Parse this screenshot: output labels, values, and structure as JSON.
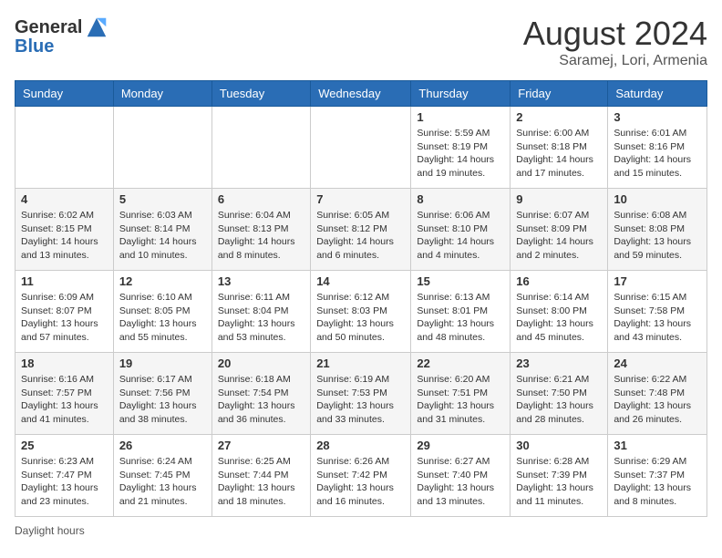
{
  "header": {
    "logo": {
      "general": "General",
      "blue": "Blue"
    },
    "title": "August 2024",
    "location": "Saramej, Lori, Armenia"
  },
  "days_of_week": [
    "Sunday",
    "Monday",
    "Tuesday",
    "Wednesday",
    "Thursday",
    "Friday",
    "Saturday"
  ],
  "weeks": [
    [
      {
        "day": null
      },
      {
        "day": null
      },
      {
        "day": null
      },
      {
        "day": null
      },
      {
        "day": 1,
        "sunrise": "Sunrise: 5:59 AM",
        "sunset": "Sunset: 8:19 PM",
        "daylight": "Daylight: 14 hours and 19 minutes."
      },
      {
        "day": 2,
        "sunrise": "Sunrise: 6:00 AM",
        "sunset": "Sunset: 8:18 PM",
        "daylight": "Daylight: 14 hours and 17 minutes."
      },
      {
        "day": 3,
        "sunrise": "Sunrise: 6:01 AM",
        "sunset": "Sunset: 8:16 PM",
        "daylight": "Daylight: 14 hours and 15 minutes."
      }
    ],
    [
      {
        "day": 4,
        "sunrise": "Sunrise: 6:02 AM",
        "sunset": "Sunset: 8:15 PM",
        "daylight": "Daylight: 14 hours and 13 minutes."
      },
      {
        "day": 5,
        "sunrise": "Sunrise: 6:03 AM",
        "sunset": "Sunset: 8:14 PM",
        "daylight": "Daylight: 14 hours and 10 minutes."
      },
      {
        "day": 6,
        "sunrise": "Sunrise: 6:04 AM",
        "sunset": "Sunset: 8:13 PM",
        "daylight": "Daylight: 14 hours and 8 minutes."
      },
      {
        "day": 7,
        "sunrise": "Sunrise: 6:05 AM",
        "sunset": "Sunset: 8:12 PM",
        "daylight": "Daylight: 14 hours and 6 minutes."
      },
      {
        "day": 8,
        "sunrise": "Sunrise: 6:06 AM",
        "sunset": "Sunset: 8:10 PM",
        "daylight": "Daylight: 14 hours and 4 minutes."
      },
      {
        "day": 9,
        "sunrise": "Sunrise: 6:07 AM",
        "sunset": "Sunset: 8:09 PM",
        "daylight": "Daylight: 14 hours and 2 minutes."
      },
      {
        "day": 10,
        "sunrise": "Sunrise: 6:08 AM",
        "sunset": "Sunset: 8:08 PM",
        "daylight": "Daylight: 13 hours and 59 minutes."
      }
    ],
    [
      {
        "day": 11,
        "sunrise": "Sunrise: 6:09 AM",
        "sunset": "Sunset: 8:07 PM",
        "daylight": "Daylight: 13 hours and 57 minutes."
      },
      {
        "day": 12,
        "sunrise": "Sunrise: 6:10 AM",
        "sunset": "Sunset: 8:05 PM",
        "daylight": "Daylight: 13 hours and 55 minutes."
      },
      {
        "day": 13,
        "sunrise": "Sunrise: 6:11 AM",
        "sunset": "Sunset: 8:04 PM",
        "daylight": "Daylight: 13 hours and 53 minutes."
      },
      {
        "day": 14,
        "sunrise": "Sunrise: 6:12 AM",
        "sunset": "Sunset: 8:03 PM",
        "daylight": "Daylight: 13 hours and 50 minutes."
      },
      {
        "day": 15,
        "sunrise": "Sunrise: 6:13 AM",
        "sunset": "Sunset: 8:01 PM",
        "daylight": "Daylight: 13 hours and 48 minutes."
      },
      {
        "day": 16,
        "sunrise": "Sunrise: 6:14 AM",
        "sunset": "Sunset: 8:00 PM",
        "daylight": "Daylight: 13 hours and 45 minutes."
      },
      {
        "day": 17,
        "sunrise": "Sunrise: 6:15 AM",
        "sunset": "Sunset: 7:58 PM",
        "daylight": "Daylight: 13 hours and 43 minutes."
      }
    ],
    [
      {
        "day": 18,
        "sunrise": "Sunrise: 6:16 AM",
        "sunset": "Sunset: 7:57 PM",
        "daylight": "Daylight: 13 hours and 41 minutes."
      },
      {
        "day": 19,
        "sunrise": "Sunrise: 6:17 AM",
        "sunset": "Sunset: 7:56 PM",
        "daylight": "Daylight: 13 hours and 38 minutes."
      },
      {
        "day": 20,
        "sunrise": "Sunrise: 6:18 AM",
        "sunset": "Sunset: 7:54 PM",
        "daylight": "Daylight: 13 hours and 36 minutes."
      },
      {
        "day": 21,
        "sunrise": "Sunrise: 6:19 AM",
        "sunset": "Sunset: 7:53 PM",
        "daylight": "Daylight: 13 hours and 33 minutes."
      },
      {
        "day": 22,
        "sunrise": "Sunrise: 6:20 AM",
        "sunset": "Sunset: 7:51 PM",
        "daylight": "Daylight: 13 hours and 31 minutes."
      },
      {
        "day": 23,
        "sunrise": "Sunrise: 6:21 AM",
        "sunset": "Sunset: 7:50 PM",
        "daylight": "Daylight: 13 hours and 28 minutes."
      },
      {
        "day": 24,
        "sunrise": "Sunrise: 6:22 AM",
        "sunset": "Sunset: 7:48 PM",
        "daylight": "Daylight: 13 hours and 26 minutes."
      }
    ],
    [
      {
        "day": 25,
        "sunrise": "Sunrise: 6:23 AM",
        "sunset": "Sunset: 7:47 PM",
        "daylight": "Daylight: 13 hours and 23 minutes."
      },
      {
        "day": 26,
        "sunrise": "Sunrise: 6:24 AM",
        "sunset": "Sunset: 7:45 PM",
        "daylight": "Daylight: 13 hours and 21 minutes."
      },
      {
        "day": 27,
        "sunrise": "Sunrise: 6:25 AM",
        "sunset": "Sunset: 7:44 PM",
        "daylight": "Daylight: 13 hours and 18 minutes."
      },
      {
        "day": 28,
        "sunrise": "Sunrise: 6:26 AM",
        "sunset": "Sunset: 7:42 PM",
        "daylight": "Daylight: 13 hours and 16 minutes."
      },
      {
        "day": 29,
        "sunrise": "Sunrise: 6:27 AM",
        "sunset": "Sunset: 7:40 PM",
        "daylight": "Daylight: 13 hours and 13 minutes."
      },
      {
        "day": 30,
        "sunrise": "Sunrise: 6:28 AM",
        "sunset": "Sunset: 7:39 PM",
        "daylight": "Daylight: 13 hours and 11 minutes."
      },
      {
        "day": 31,
        "sunrise": "Sunrise: 6:29 AM",
        "sunset": "Sunset: 7:37 PM",
        "daylight": "Daylight: 13 hours and 8 minutes."
      }
    ]
  ],
  "footer": {
    "daylight_hours": "Daylight hours"
  }
}
